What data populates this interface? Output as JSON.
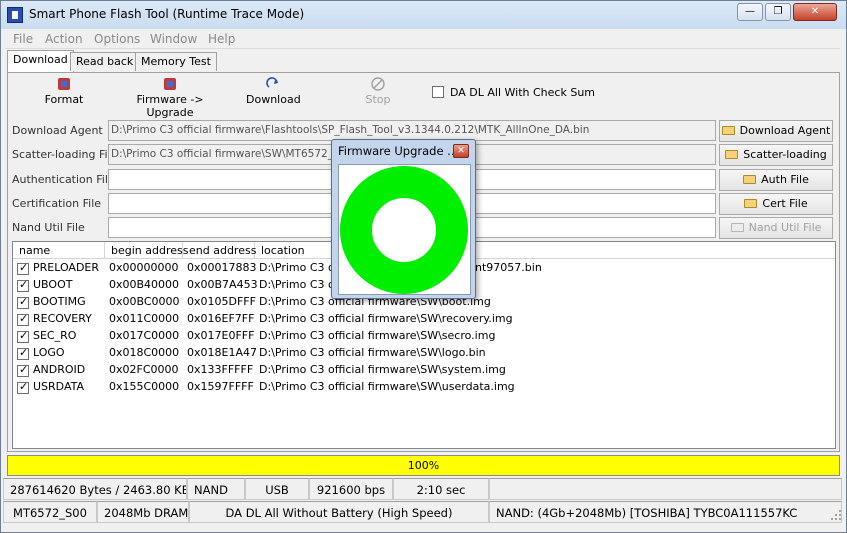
{
  "window": {
    "title": "Smart Phone Flash Tool (Runtime Trace Mode)",
    "min_glyph": "—",
    "max_glyph": "❐",
    "close_glyph": "✕",
    "accent_titlebar": "#c9dcf0",
    "close_color": "#c8402a"
  },
  "menu": [
    "File",
    "Action",
    "Options",
    "Window",
    "Help"
  ],
  "tabs": [
    "Download",
    "Read back",
    "Memory Test"
  ],
  "toolbar": {
    "format": "Format",
    "firmware_upgrade": "Firmware -> Upgrade",
    "download": "Download",
    "stop": "Stop",
    "checksum_label": "DA DL All With Check Sum",
    "checksum_checked": false
  },
  "fields": [
    {
      "label": "Download Agent",
      "value": "D:\\Primo C3 official firmware\\Flashtools\\SP_Flash_Tool_v3.1344.0.212\\MTK_AllInOne_DA.bin",
      "button": "Download Agent"
    },
    {
      "label": "Scatter-loading File",
      "value": "D:\\Primo C3 official firmware\\SW\\MT6572_Ar",
      "button": "Scatter-loading"
    },
    {
      "label": "Authentication File",
      "value": "",
      "button": "Auth File"
    },
    {
      "label": "Certification File",
      "value": "",
      "button": "Cert File"
    },
    {
      "label": "Nand Util File",
      "value": "",
      "button": "Nand Util File"
    }
  ],
  "table": {
    "columns": [
      "name",
      "begin address",
      "end address",
      "location"
    ],
    "rows": [
      {
        "name": "PRELOADER",
        "begin": "0x00000000",
        "end": "0x00017883",
        "location": "D:\\Primo C3 of",
        "tail": "nt97057.bin"
      },
      {
        "name": "UBOOT",
        "begin": "0x00B40000",
        "end": "0x00B7A453",
        "location": "D:\\Primo C3 of",
        "tail": ""
      },
      {
        "name": "BOOTIMG",
        "begin": "0x00BC0000",
        "end": "0x0105DFFF",
        "location": "D:\\Primo C3 official firmware\\SW\\boot.img",
        "tail": ""
      },
      {
        "name": "RECOVERY",
        "begin": "0x011C0000",
        "end": "0x016EF7FF",
        "location": "D:\\Primo C3 official firmware\\SW\\recovery.img",
        "tail": ""
      },
      {
        "name": "SEC_RO",
        "begin": "0x017C0000",
        "end": "0x017E0FFF",
        "location": "D:\\Primo C3 official firmware\\SW\\secro.img",
        "tail": ""
      },
      {
        "name": "LOGO",
        "begin": "0x018C0000",
        "end": "0x018E1A47",
        "location": "D:\\Primo C3 official firmware\\SW\\logo.bin",
        "tail": ""
      },
      {
        "name": "ANDROID",
        "begin": "0x02FC0000",
        "end": "0x133FFFFF",
        "location": "D:\\Primo C3 official firmware\\SW\\system.img",
        "tail": ""
      },
      {
        "name": "USRDATA",
        "begin": "0x155C0000",
        "end": "0x1597FFFF",
        "location": "D:\\Primo C3 official firmware\\SW\\userdata.img",
        "tail": ""
      }
    ]
  },
  "progress": {
    "label": "100%",
    "fraction": 1.0,
    "color": "#ffff00"
  },
  "status1": {
    "bytes": "287614620 Bytes / 2463.80 KBps",
    "storage": "NAND",
    "port": "USB",
    "baud": "921600 bps",
    "time": "2:10 sec"
  },
  "status2": {
    "chip": "MT6572_S00",
    "dram": "2048Mb DRAM",
    "mode": "DA DL All Without Battery (High Speed)",
    "nand": "NAND: (4Gb+2048Mb) [TOSHIBA] TYBC0A111557KC"
  },
  "dialog": {
    "title": "Firmware Upgrade ...",
    "close_glyph": "✕",
    "ring_color": "#00ee00"
  }
}
